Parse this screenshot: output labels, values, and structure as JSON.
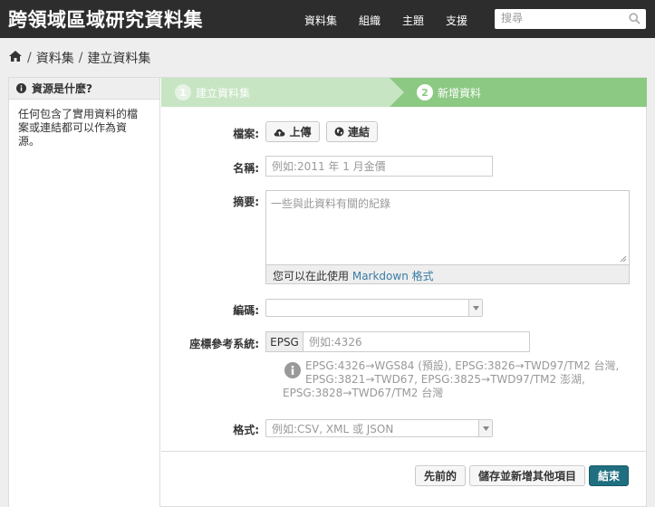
{
  "site": {
    "title": "跨領域區域研究資料集"
  },
  "nav": {
    "items": [
      "資料集",
      "組織",
      "主題",
      "支援"
    ]
  },
  "search": {
    "placeholder": "搜尋"
  },
  "breadcrumb": {
    "items": [
      "資料集",
      "建立資料集"
    ],
    "separator": "/"
  },
  "sidebar": {
    "heading": "資源是什麽?",
    "body_line1": "任何包含了實用資料的檔",
    "body_line2": "案或連結都可以作為資",
    "body_line3": "源。"
  },
  "stages": [
    {
      "num": "1",
      "label": "建立資料集",
      "state": "complete"
    },
    {
      "num": "2",
      "label": "新增資料",
      "state": "active"
    }
  ],
  "form": {
    "file_label": "檔案:",
    "upload_label": "上傳",
    "link_label": "連結",
    "name_label": "名稱:",
    "name_placeholder": "例如:2011 年 1 月金價",
    "desc_label": "摘要:",
    "desc_placeholder": "一些與此資料有關的紀錄",
    "markdown_prefix": "您可以在此使用",
    "markdown_link": "Markdown 格式",
    "encoding_label": "編碼:",
    "encoding_value": "",
    "crs_label": "座標參考系統:",
    "crs_prefix": "EPSG",
    "crs_placeholder": "例如:4326",
    "crs_help_line1": "EPSG:4326→WGS84 (預設), EPSG:3826→TWD97/TM2 台灣,",
    "crs_help_line2": "EPSG:3821→TWD67, EPSG:3825→TWD97/TM2 澎湖,",
    "crs_help_line3": "EPSG:3828→TWD67/TM2 台灣",
    "format_label": "格式:",
    "format_placeholder": "例如:CSV, XML 或 JSON"
  },
  "actions": {
    "previous": "先前的",
    "save_add": "儲存並新增其他項目",
    "finish": "結束"
  },
  "colors": {
    "header_bg": "#2d2d2d",
    "stage_complete": "#c7e5c3",
    "stage_active": "#8cc983",
    "primary_button": "#1f6f80",
    "link": "#3a7ca5"
  }
}
